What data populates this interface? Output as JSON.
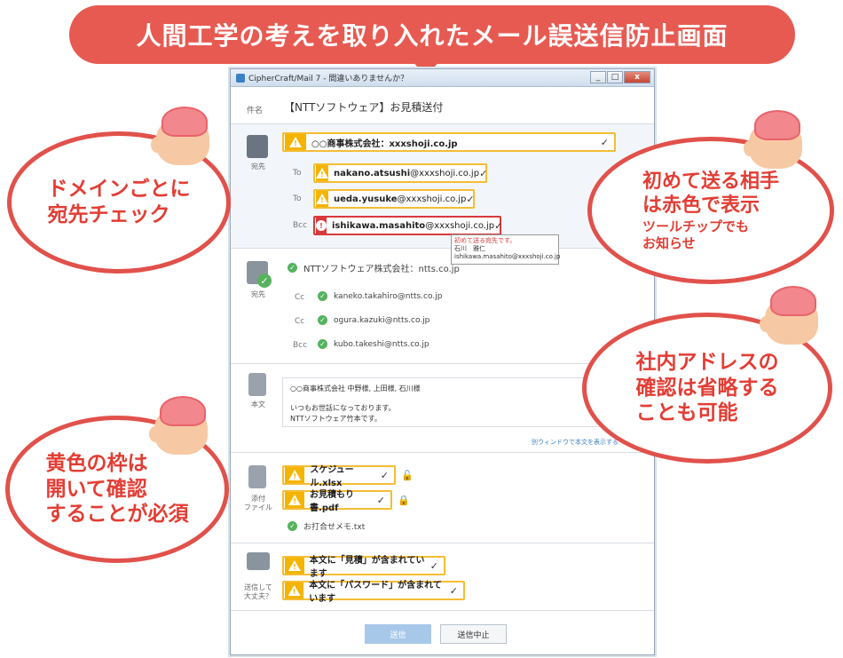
{
  "banner_title": "人間工学の考えを取り入れたメール誤送信防止画面",
  "window": {
    "title": "CipherCraft/Mail 7 - 間違いありませんか？",
    "controls": [
      "_",
      "□",
      "x"
    ]
  },
  "subject": {
    "label": "件名",
    "value": "【NTTソフトウェア】お見積送付"
  },
  "external": {
    "side_label": "宛先",
    "domain": "○○商事株式会社：xxxshoji.co.jp",
    "recipients": [
      {
        "field": "To",
        "local": "nakano.atsushi",
        "domain": "@xxxshoji.co.jp",
        "style": "warn"
      },
      {
        "field": "To",
        "local": "ueda.yusuke",
        "domain": "@xxxshoji.co.jp",
        "style": "warn"
      },
      {
        "field": "Bcc",
        "local": "ishikawa.masahito",
        "domain": "@xxxshoji.co.jp",
        "style": "danger"
      }
    ],
    "tooltip": {
      "line1": "初めて送る宛先です。",
      "line2": "石川　雅仁",
      "line3": "ishikawa.masahito@xxxshoji.co.jp"
    }
  },
  "internal": {
    "side_label": "宛先",
    "domain": "NTTソフトウェア株式会社：ntts.co.jp",
    "recipients": [
      {
        "field": "Cc",
        "address": "kaneko.takahiro@ntts.co.jp"
      },
      {
        "field": "Cc",
        "address": "ogura.kazuki@ntts.co.jp"
      },
      {
        "field": "Bcc",
        "address": "kubo.takeshi@ntts.co.jp"
      }
    ]
  },
  "body": {
    "side_label": "本文",
    "line1": "○○商事株式会社  中野様, 上田様, 石川様",
    "line2": "いつもお世話になっております。",
    "line3": "NTTソフトウェア竹本です。",
    "open_link": "別ウィンドウで本文を表示する"
  },
  "attachments": {
    "side_label_1": "添付",
    "side_label_2": "ファイル",
    "items": [
      {
        "name": "スケジュール.xlsx",
        "lock": "unlocked"
      },
      {
        "name": "お見積もり書.pdf",
        "lock": "locked"
      }
    ],
    "ok_item": "お打合せメモ.txt"
  },
  "confirm": {
    "side_label_1": "送信して",
    "side_label_2": "大丈夫？",
    "items": [
      "本文に「見積」が含まれています",
      "本文に「パスワード」が含まれています"
    ]
  },
  "buttons": {
    "send": "送信",
    "cancel": "送信中止"
  },
  "callouts": {
    "domain_check": [
      "ドメインごとに",
      "宛先チェック"
    ],
    "first_time": [
      "初めて送る相手",
      "は赤色で表示"
    ],
    "first_time_sub": [
      "ツールチップでも",
      "お知らせ"
    ],
    "internal": [
      "社内アドレスの",
      "確認は省略する",
      "ことも可能"
    ],
    "yellow": [
      "黄色の枠は",
      "開いて確認",
      "することが必須"
    ]
  },
  "colors": {
    "banner": "#e75a52",
    "warn": "#f5bd34",
    "danger": "#d8393b",
    "ok": "#56b25e"
  }
}
